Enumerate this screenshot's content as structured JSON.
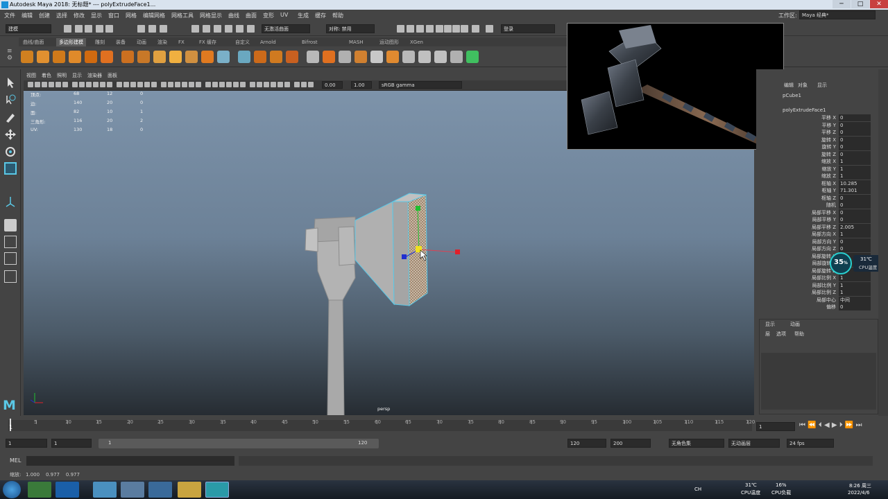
{
  "window": {
    "title": "Autodesk Maya 2018: 无标题*   ---   polyExtrudeFace1..."
  },
  "menubar": {
    "items": [
      "文件",
      "编辑",
      "创建",
      "选择",
      "修改",
      "显示",
      "窗口",
      "网格",
      "编辑网格",
      "网格工具",
      "网格显示",
      "曲线",
      "曲面",
      "变形",
      "UV",
      "生成",
      "缓存",
      "帮助"
    ],
    "workspace_label": "工作区:",
    "workspace_value": "Maya 经典*"
  },
  "statusline": {
    "mode": "建模",
    "live_surface": "无激活曲面",
    "symmetry": "对称: 禁用",
    "login": "登录"
  },
  "shelf": {
    "tabs": [
      "曲线/曲面",
      "多边形建模",
      "雕刻",
      "装备",
      "动画",
      "渲染",
      "FX",
      "FX 缓存",
      "自定义",
      "Arnold",
      "Bifrost",
      "MASH",
      "运动图形",
      "XGen"
    ],
    "active_tab": "多边形建模"
  },
  "panel": {
    "menus": [
      "视图",
      "着色",
      "照明",
      "显示",
      "渲染器",
      "面板"
    ],
    "exposure": "0.00",
    "gamma": "1.00",
    "color_space": "sRGB gamma"
  },
  "hud": {
    "rows": [
      {
        "label": "顶点:",
        "a": "68",
        "b": "12",
        "c": "0"
      },
      {
        "label": "边:",
        "a": "140",
        "b": "20",
        "c": "0"
      },
      {
        "label": "面:",
        "a": "82",
        "b": "10",
        "c": "1"
      },
      {
        "label": "三角形:",
        "a": "116",
        "b": "20",
        "c": "2"
      },
      {
        "label": "UV:",
        "a": "130",
        "b": "18",
        "c": "0"
      }
    ],
    "camera": "persp"
  },
  "channelbox": {
    "menus": [
      "编辑",
      "对象",
      "显示"
    ],
    "object": "pCube1",
    "node": "polyExtrudeFace1",
    "attrs": [
      {
        "label": "平移 X",
        "value": "0"
      },
      {
        "label": "平移 Y",
        "value": "0"
      },
      {
        "label": "平移 Z",
        "value": "0"
      },
      {
        "label": "旋转 X",
        "value": "0"
      },
      {
        "label": "旋转 Y",
        "value": "0"
      },
      {
        "label": "旋转 Z",
        "value": "0"
      },
      {
        "label": "缩放 X",
        "value": "1"
      },
      {
        "label": "缩放 Y",
        "value": "1"
      },
      {
        "label": "缩放 Z",
        "value": "1"
      },
      {
        "label": "枢轴 X",
        "value": "10.285"
      },
      {
        "label": "枢轴 Y",
        "value": "71.301"
      },
      {
        "label": "枢轴 Z",
        "value": "0"
      },
      {
        "label": "随机",
        "value": "0"
      },
      {
        "label": "局部平移 X",
        "value": "0"
      },
      {
        "label": "局部平移 Y",
        "value": "0"
      },
      {
        "label": "局部平移 Z",
        "value": "2.005"
      },
      {
        "label": "局部方向 X",
        "value": "1"
      },
      {
        "label": "局部方向 Y",
        "value": "0"
      },
      {
        "label": "局部方向 Z",
        "value": "0"
      },
      {
        "label": "局部旋转 X",
        "value": "0"
      },
      {
        "label": "局部旋转 Y",
        "value": "0"
      },
      {
        "label": "局部旋转 Z",
        "value": "0"
      },
      {
        "label": "局部比例 X",
        "value": "1"
      },
      {
        "label": "局部比例 Y",
        "value": "1"
      },
      {
        "label": "局部比例 Z",
        "value": "1"
      },
      {
        "label": "局部中心",
        "value": "中间"
      },
      {
        "label": "偏移",
        "value": "0"
      }
    ]
  },
  "layer_panel": {
    "tabs": [
      "显示",
      "动画"
    ],
    "menus": [
      "层",
      "选项",
      "帮助"
    ]
  },
  "timeline": {
    "ticks": [
      "5",
      "10",
      "15",
      "20",
      "25",
      "30",
      "35",
      "40",
      "45",
      "50",
      "55",
      "60",
      "65",
      "70",
      "75",
      "80",
      "85",
      "90",
      "95",
      "100",
      "105",
      "110",
      "115",
      "120"
    ],
    "start_marker": "1",
    "current_frame": "1"
  },
  "range": {
    "start": "1",
    "anim_start": "1",
    "range_start": "1",
    "range_end": "120",
    "anim_end": "120",
    "end": "200",
    "character_set": "无角色集",
    "anim_layer": "无动画层",
    "fps": "24 fps"
  },
  "cmdline": {
    "label": "MEL"
  },
  "helpline": {
    "text": "缩放:   1.000    0.977    0.977"
  },
  "cpu_widget": {
    "percent": "35",
    "percent_sign": "%",
    "temp": "31℃",
    "label": "CPU温度"
  },
  "taskbar": {
    "temp": "31℃",
    "temp_label": "CPU温度",
    "load": "16%",
    "load_label": "CPU负载",
    "lang": "CH",
    "time": "8:26 周三",
    "date": "2022/4/6"
  },
  "colors": {
    "maya_bg": "#444444",
    "accent": "#5ac8e6",
    "manip_x": "#e0202a",
    "manip_y": "#20c030",
    "manip_z": "#2030d0"
  }
}
